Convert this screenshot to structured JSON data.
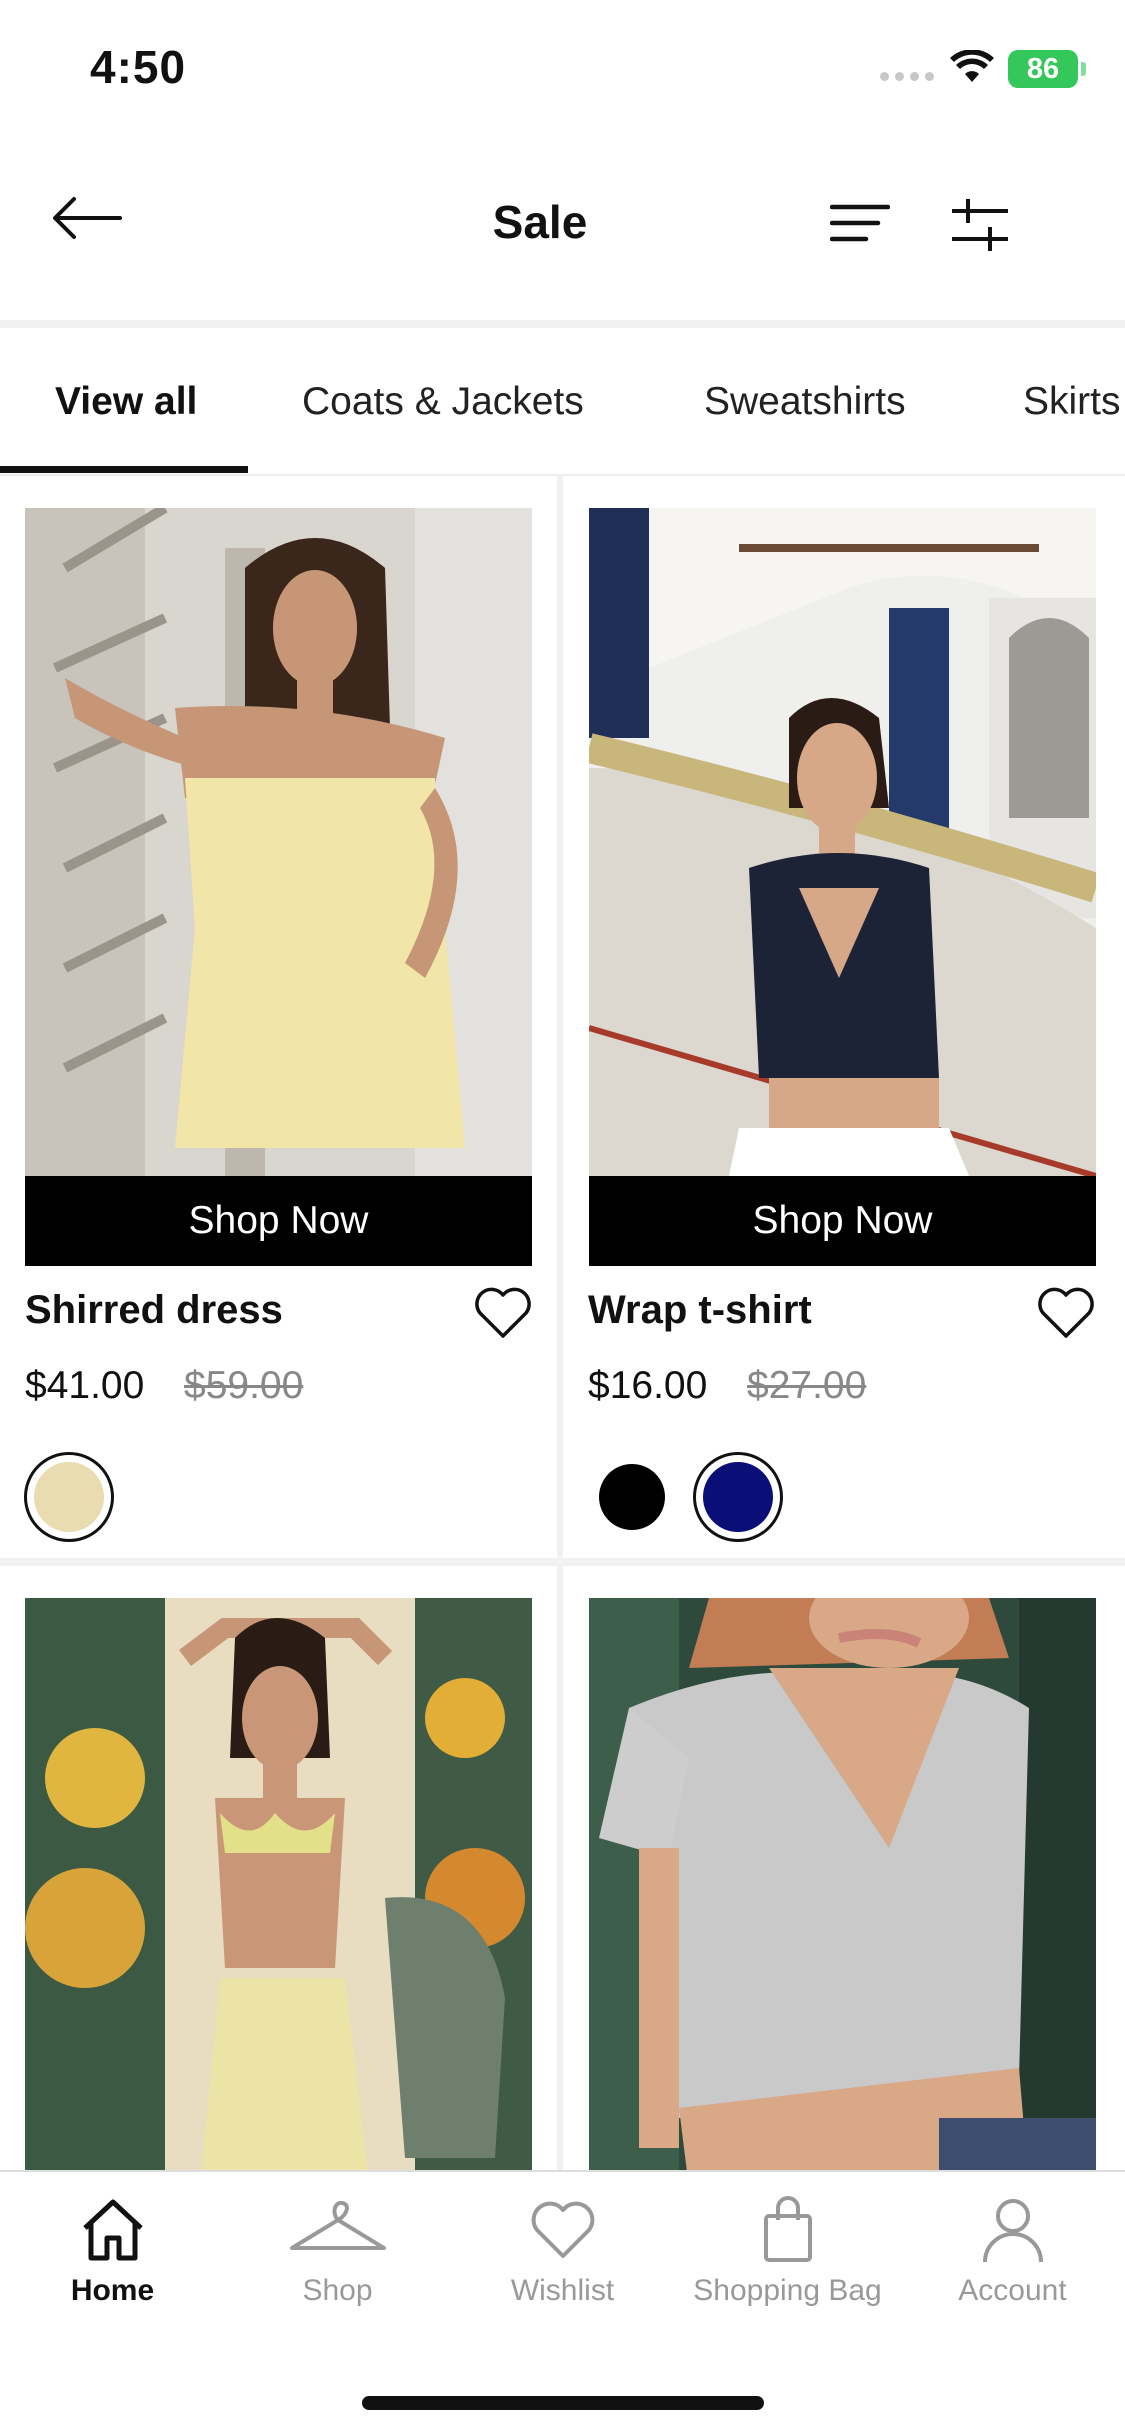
{
  "status_bar": {
    "time": "4:50",
    "battery": "86"
  },
  "header": {
    "title": "Sale"
  },
  "tabs": [
    {
      "label": "View all",
      "active": true
    },
    {
      "label": "Coats & Jackets"
    },
    {
      "label": "Sweatshirts"
    },
    {
      "label": "Skirts"
    }
  ],
  "products": [
    {
      "name": "Shirred dress",
      "cta": "Shop Now",
      "price": "$41.00",
      "old_price": "$59.00",
      "swatches": [
        {
          "color": "#e8dcb0",
          "selected": true
        }
      ]
    },
    {
      "name": "Wrap t-shirt",
      "cta": "Shop Now",
      "price": "$16.00",
      "old_price": "$27.00",
      "swatches": [
        {
          "color": "#000000",
          "selected": false
        },
        {
          "color": "#0a0f78",
          "selected": true
        }
      ]
    }
  ],
  "tabbar": [
    {
      "label": "Home",
      "icon": "home-icon",
      "active": true
    },
    {
      "label": "Shop",
      "icon": "hanger-icon"
    },
    {
      "label": "Wishlist",
      "icon": "heart-icon"
    },
    {
      "label": "Shopping Bag",
      "icon": "bag-icon"
    },
    {
      "label": "Account",
      "icon": "person-icon"
    }
  ],
  "colors": {
    "accent": "#000000",
    "battery": "#34c759",
    "muted": "#999999"
  }
}
